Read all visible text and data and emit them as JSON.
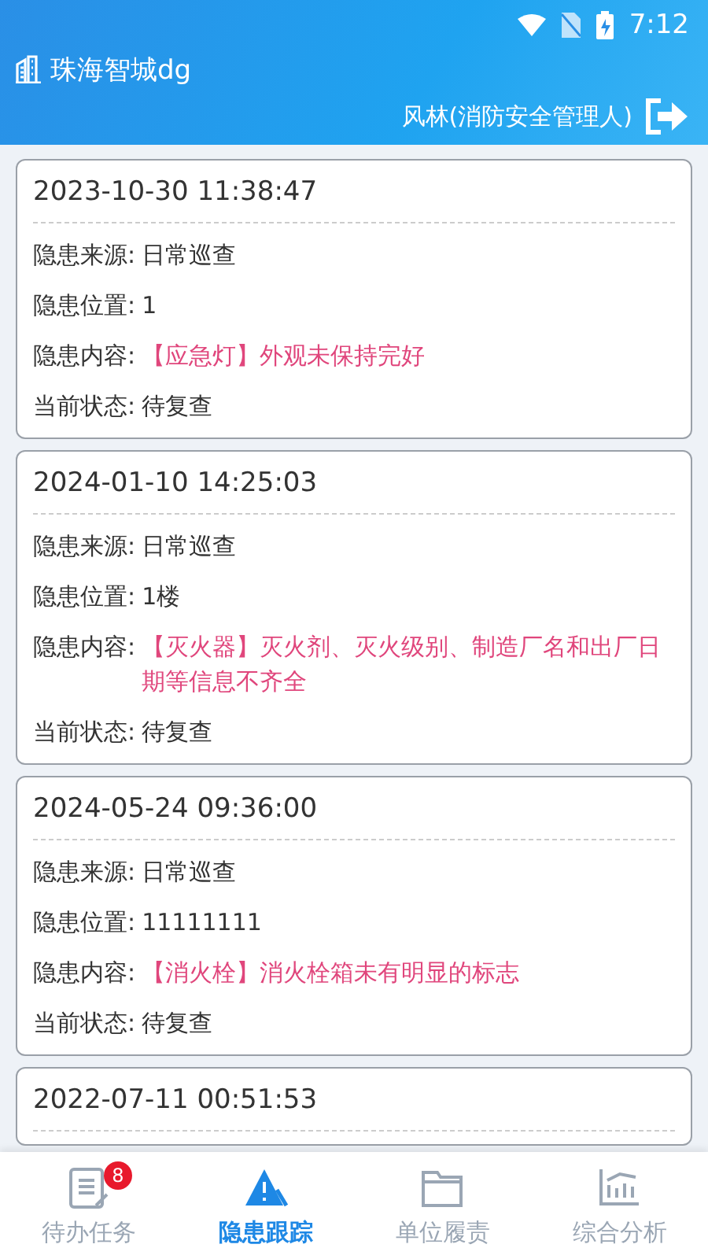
{
  "status_bar": {
    "time": "7:12"
  },
  "header": {
    "app_title": "珠海智城dg",
    "user": "风林(消防安全管理人)"
  },
  "records": [
    {
      "time": "2023-10-30 11:38:47",
      "fields": [
        {
          "label": "隐患来源:",
          "value": "日常巡查",
          "kind": "plain"
        },
        {
          "label": "隐患位置:",
          "value": "1",
          "kind": "plain"
        },
        {
          "label": "隐患内容:",
          "value": "【应急灯】外观未保持完好",
          "kind": "highlight"
        },
        {
          "label": "当前状态:",
          "value": "待复查",
          "kind": "plain"
        }
      ]
    },
    {
      "time": "2024-01-10 14:25:03",
      "fields": [
        {
          "label": "隐患来源:",
          "value": "日常巡查",
          "kind": "plain"
        },
        {
          "label": "隐患位置:",
          "value": "1楼",
          "kind": "plain"
        },
        {
          "label": "隐患内容:",
          "value": "【灭火器】灭火剂、灭火级别、制造厂名和出厂日期等信息不齐全",
          "kind": "highlight"
        },
        {
          "label": "当前状态:",
          "value": "待复查",
          "kind": "plain"
        }
      ]
    },
    {
      "time": "2024-05-24 09:36:00",
      "fields": [
        {
          "label": "隐患来源:",
          "value": "日常巡查",
          "kind": "plain"
        },
        {
          "label": "隐患位置:",
          "value": "11111111",
          "kind": "plain"
        },
        {
          "label": "隐患内容:",
          "value": "【消火栓】消火栓箱未有明显的标志",
          "kind": "highlight"
        },
        {
          "label": "当前状态:",
          "value": "待复查",
          "kind": "plain"
        }
      ]
    },
    {
      "time": "2022-07-11 00:51:53"
    }
  ],
  "tabs": [
    {
      "label": "待办任务",
      "selected": false,
      "badge": "8",
      "kind": "tasks"
    },
    {
      "label": "隐患跟踪",
      "selected": true,
      "kind": "hazard"
    },
    {
      "label": "单位履责",
      "selected": false,
      "kind": "folder"
    },
    {
      "label": "综合分析",
      "selected": false,
      "kind": "chart"
    }
  ]
}
